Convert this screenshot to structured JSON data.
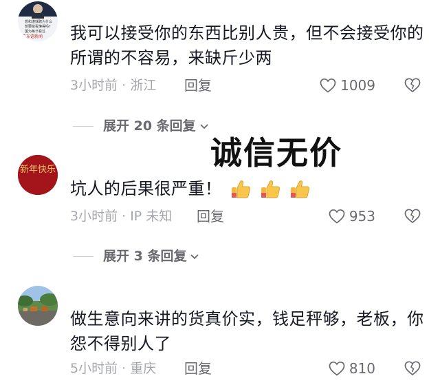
{
  "comments": [
    {
      "text": "我可以接受你的东西比别人贵，但不会接受你的所谓的不容易，来缺斤少两",
      "meta": "3小时前 · 浙江",
      "reply_label": "回复",
      "likes": "1009",
      "avatar_icon": "news-poster-avatar",
      "avatar_texts": [
        "想和湛妹聘为什么",
        "想要能看懂得吗？",
        "因为每日看过",
        "广东语新闻"
      ]
    },
    {
      "text": "坑人的后果很严重！",
      "meta": "3小时前 · IP 未知",
      "reply_label": "回复",
      "likes": "953",
      "emojis": [
        "thumbs-up-emoji",
        "thumbs-up-emoji",
        "thumbs-up-emoji"
      ],
      "avatar_icon": "calligraphy-avatar",
      "avatar_text": "新年快乐"
    },
    {
      "text": "做生意向来讲的货真价实，钱足秤够，老板，你怨不得别人了",
      "meta": "5小时前 · 重庆",
      "reply_label": "回复",
      "likes": "810",
      "avatar_icon": "landscape-photo-avatar"
    }
  ],
  "expand_replies": [
    {
      "label": "展开 20 条回复"
    },
    {
      "label": "展开 3 条回复"
    }
  ],
  "overlay_caption": "诚信无价",
  "colors": {
    "text": "#161823",
    "meta": "#a6a7ab",
    "secondary": "#69686f",
    "avatar_red": "#a3151b",
    "gold": "#e8c46a"
  }
}
